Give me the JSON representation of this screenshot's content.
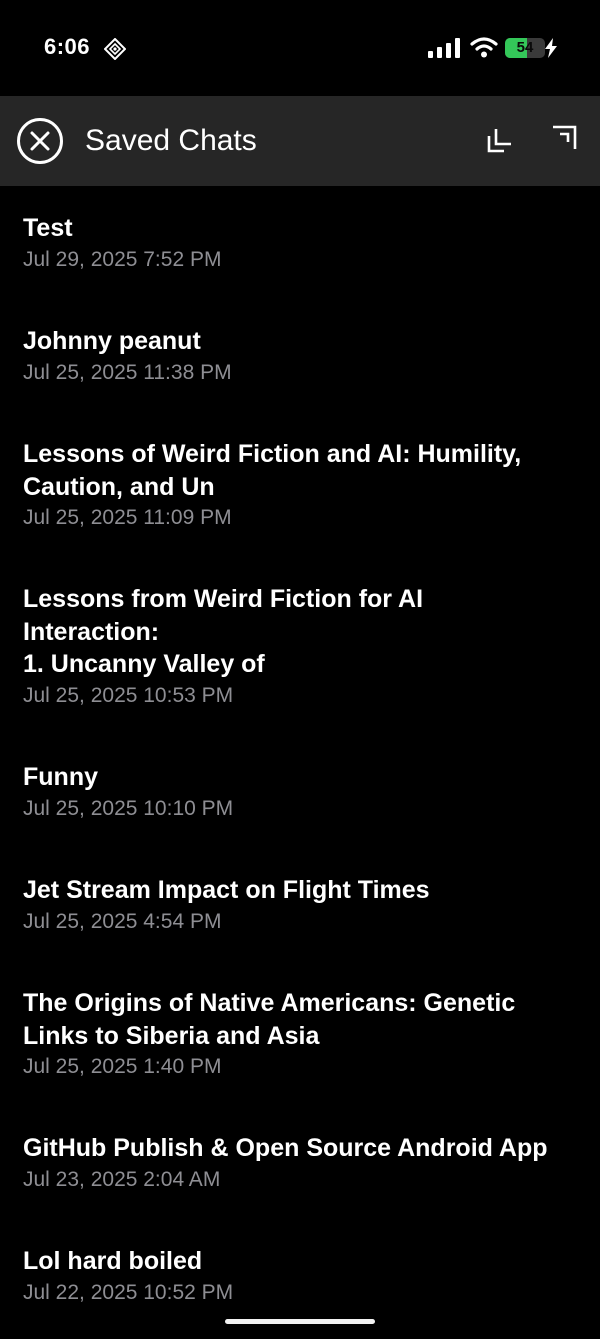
{
  "status_bar": {
    "time": "6:06",
    "battery_percent": "54",
    "battery_level": 0.54,
    "charging": true,
    "icons": [
      "diamond-icon",
      "cellular-signal-icon",
      "wifi-icon",
      "battery-icon",
      "charging-bolt-icon"
    ]
  },
  "header": {
    "title": "Saved Chats",
    "icons": [
      "close-circle-icon",
      "collapse-icon",
      "expand-icon"
    ]
  },
  "colors": {
    "background": "#000000",
    "header_bg": "#262626",
    "title_text": "#ffffff",
    "date_text": "#8e8e93",
    "battery_green": "#34c759"
  },
  "chats": [
    {
      "title": "Test",
      "date": "Jul 29, 2025 7:52 PM"
    },
    {
      "title": "Johnny peanut",
      "date": "Jul 25, 2025 11:38 PM"
    },
    {
      "title": "Lessons of Weird Fiction and AI: Humility,\nCaution, and Un",
      "date": "Jul 25, 2025 11:09 PM"
    },
    {
      "title": "Lessons from Weird Fiction for AI\nInteraction:\n1. Uncanny Valley of",
      "date": "Jul 25, 2025 10:53 PM"
    },
    {
      "title": "Funny",
      "date": "Jul 25, 2025 10:10 PM"
    },
    {
      "title": "Jet Stream Impact on Flight Times",
      "date": "Jul 25, 2025 4:54 PM"
    },
    {
      "title": "The Origins of Native Americans: Genetic\nLinks to Siberia and Asia",
      "date": "Jul 25, 2025 1:40 PM"
    },
    {
      "title": "GitHub Publish & Open Source Android App",
      "date": "Jul 23, 2025 2:04 AM"
    },
    {
      "title": "Lol hard boiled",
      "date": "Jul 22, 2025 10:52 PM"
    }
  ]
}
